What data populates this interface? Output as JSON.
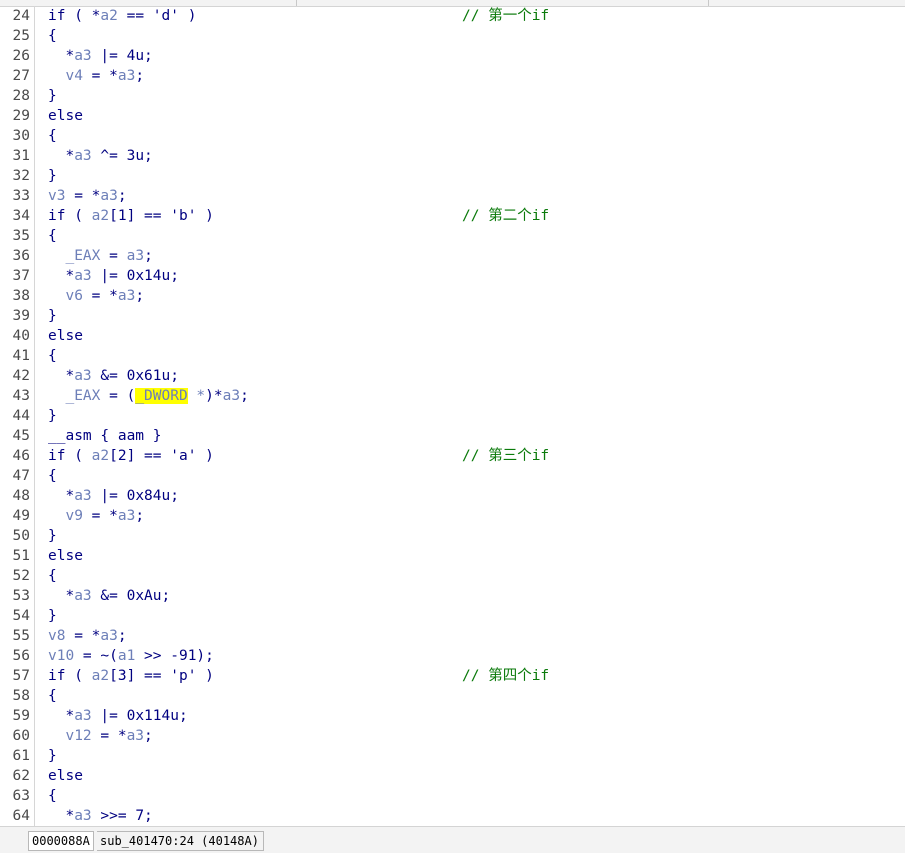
{
  "editor": {
    "lines": [
      {
        "n": "24",
        "c": [
          [
            "kw",
            "if ( *"
          ],
          [
            "var",
            "a2"
          ],
          [
            "kw",
            " == 'd' )"
          ]
        ],
        "cm": "// 第一个if"
      },
      {
        "n": "25",
        "c": [
          [
            "kw",
            "{"
          ]
        ]
      },
      {
        "n": "26",
        "c": [
          [
            "kw",
            "  *"
          ],
          [
            "var",
            "a3"
          ],
          [
            "kw",
            " |= 4u;"
          ]
        ]
      },
      {
        "n": "27",
        "c": [
          [
            "var",
            "  v4"
          ],
          [
            "kw",
            " = *"
          ],
          [
            "var",
            "a3"
          ],
          [
            "kw",
            ";"
          ]
        ]
      },
      {
        "n": "28",
        "c": [
          [
            "kw",
            "}"
          ]
        ]
      },
      {
        "n": "29",
        "c": [
          [
            "kw",
            "else"
          ]
        ]
      },
      {
        "n": "30",
        "c": [
          [
            "kw",
            "{"
          ]
        ]
      },
      {
        "n": "31",
        "c": [
          [
            "kw",
            "  *"
          ],
          [
            "var",
            "a3"
          ],
          [
            "kw",
            " ^= 3u;"
          ]
        ]
      },
      {
        "n": "32",
        "c": [
          [
            "kw",
            "}"
          ]
        ]
      },
      {
        "n": "33",
        "c": [
          [
            "var",
            "v3"
          ],
          [
            "kw",
            " = *"
          ],
          [
            "var",
            "a3"
          ],
          [
            "kw",
            ";"
          ]
        ]
      },
      {
        "n": "34",
        "c": [
          [
            "kw",
            "if ( "
          ],
          [
            "var",
            "a2"
          ],
          [
            "kw",
            "[1] == 'b' )"
          ]
        ],
        "cm": "// 第二个if"
      },
      {
        "n": "35",
        "c": [
          [
            "kw",
            "{"
          ]
        ]
      },
      {
        "n": "36",
        "c": [
          [
            "var",
            "  _EAX"
          ],
          [
            "kw",
            " = "
          ],
          [
            "var",
            "a3"
          ],
          [
            "kw",
            ";"
          ]
        ]
      },
      {
        "n": "37",
        "c": [
          [
            "kw",
            "  *"
          ],
          [
            "var",
            "a3"
          ],
          [
            "kw",
            " |= 0x14u;"
          ]
        ]
      },
      {
        "n": "38",
        "c": [
          [
            "var",
            "  v6"
          ],
          [
            "kw",
            " = *"
          ],
          [
            "var",
            "a3"
          ],
          [
            "kw",
            ";"
          ]
        ]
      },
      {
        "n": "39",
        "c": [
          [
            "kw",
            "}"
          ]
        ]
      },
      {
        "n": "40",
        "c": [
          [
            "kw",
            "else"
          ]
        ]
      },
      {
        "n": "41",
        "c": [
          [
            "kw",
            "{"
          ]
        ]
      },
      {
        "n": "42",
        "c": [
          [
            "kw",
            "  *"
          ],
          [
            "var",
            "a3"
          ],
          [
            "kw",
            " &= 0x61u;"
          ]
        ]
      },
      {
        "n": "43",
        "c": [
          [
            "var",
            "  _EAX"
          ],
          [
            "kw",
            " = ("
          ],
          [
            "hl",
            "_DWORD"
          ],
          [
            "var",
            " *"
          ],
          [
            "kw",
            ")*"
          ],
          [
            "var",
            "a3"
          ],
          [
            "kw",
            ";"
          ]
        ]
      },
      {
        "n": "44",
        "c": [
          [
            "kw",
            "}"
          ]
        ]
      },
      {
        "n": "45",
        "c": [
          [
            "kw",
            "__asm { aam }"
          ]
        ]
      },
      {
        "n": "46",
        "c": [
          [
            "kw",
            "if ( "
          ],
          [
            "var",
            "a2"
          ],
          [
            "kw",
            "[2] == 'a' )"
          ]
        ],
        "cm": "// 第三个if"
      },
      {
        "n": "47",
        "c": [
          [
            "kw",
            "{"
          ]
        ]
      },
      {
        "n": "48",
        "c": [
          [
            "kw",
            "  *"
          ],
          [
            "var",
            "a3"
          ],
          [
            "kw",
            " |= 0x84u;"
          ]
        ]
      },
      {
        "n": "49",
        "c": [
          [
            "var",
            "  v9"
          ],
          [
            "kw",
            " = *"
          ],
          [
            "var",
            "a3"
          ],
          [
            "kw",
            ";"
          ]
        ]
      },
      {
        "n": "50",
        "c": [
          [
            "kw",
            "}"
          ]
        ]
      },
      {
        "n": "51",
        "c": [
          [
            "kw",
            "else"
          ]
        ]
      },
      {
        "n": "52",
        "c": [
          [
            "kw",
            "{"
          ]
        ]
      },
      {
        "n": "53",
        "c": [
          [
            "kw",
            "  *"
          ],
          [
            "var",
            "a3"
          ],
          [
            "kw",
            " &= 0xAu;"
          ]
        ]
      },
      {
        "n": "54",
        "c": [
          [
            "kw",
            "}"
          ]
        ]
      },
      {
        "n": "55",
        "c": [
          [
            "var",
            "v8"
          ],
          [
            "kw",
            " = *"
          ],
          [
            "var",
            "a3"
          ],
          [
            "kw",
            ";"
          ]
        ]
      },
      {
        "n": "56",
        "c": [
          [
            "var",
            "v10"
          ],
          [
            "kw",
            " = ~("
          ],
          [
            "var",
            "a1"
          ],
          [
            "kw",
            " >> -91);"
          ]
        ]
      },
      {
        "n": "57",
        "c": [
          [
            "kw",
            "if ( "
          ],
          [
            "var",
            "a2"
          ],
          [
            "kw",
            "[3] == 'p' )"
          ]
        ],
        "cm": "// 第四个if"
      },
      {
        "n": "58",
        "c": [
          [
            "kw",
            "{"
          ]
        ]
      },
      {
        "n": "59",
        "c": [
          [
            "kw",
            "  *"
          ],
          [
            "var",
            "a3"
          ],
          [
            "kw",
            " |= 0x114u;"
          ]
        ]
      },
      {
        "n": "60",
        "c": [
          [
            "var",
            "  v12"
          ],
          [
            "kw",
            " = *"
          ],
          [
            "var",
            "a3"
          ],
          [
            "kw",
            ";"
          ]
        ]
      },
      {
        "n": "61",
        "c": [
          [
            "kw",
            "}"
          ]
        ]
      },
      {
        "n": "62",
        "c": [
          [
            "kw",
            "else"
          ]
        ]
      },
      {
        "n": "63",
        "c": [
          [
            "kw",
            "{"
          ]
        ]
      },
      {
        "n": "64",
        "c": [
          [
            "kw",
            "  *"
          ],
          [
            "var",
            "a3"
          ],
          [
            "kw",
            " >>= 7;"
          ]
        ]
      }
    ]
  },
  "status": {
    "address": "0000088A",
    "location": "sub_401470:24 (40148A)"
  }
}
